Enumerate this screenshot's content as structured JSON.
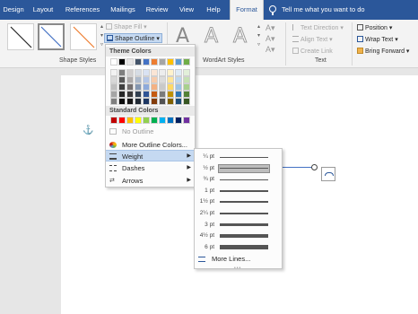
{
  "tabs": [
    {
      "label": "Design",
      "active": false
    },
    {
      "label": "Layout",
      "active": false
    },
    {
      "label": "References",
      "active": false
    },
    {
      "label": "Mailings",
      "active": false
    },
    {
      "label": "Review",
      "active": false
    },
    {
      "label": "View",
      "active": false
    },
    {
      "label": "Help",
      "active": false
    },
    {
      "label": "Format",
      "active": true
    }
  ],
  "tell_me": "Tell me what you want to do",
  "ribbon": {
    "shape_fill": "Shape Fill",
    "shape_outline": "Shape Outline",
    "shape_styles_label": "Shape Styles",
    "wordart_letter": "A",
    "wordart_label": "WordArt Styles",
    "text_direction": "Text Direction",
    "align_text": "Align Text",
    "create_link": "Create Link",
    "text_label": "Text",
    "position": "Position",
    "wrap_text": "Wrap Text",
    "bring_forward": "Bring Forward"
  },
  "outline_menu": {
    "theme_colors_label": "Theme Colors",
    "standard_colors_label": "Standard Colors",
    "theme_top": [
      "#ffffff",
      "#000000",
      "#e7e6e6",
      "#44546a",
      "#4472c4",
      "#ed7d31",
      "#a5a5a5",
      "#ffc000",
      "#5b9bd5",
      "#70ad47"
    ],
    "theme_shades": [
      [
        "#f2f2f2",
        "#7f7f7f",
        "#d0cece",
        "#d6dce4",
        "#d9e2f3",
        "#fbe5d5",
        "#ededed",
        "#fff2cc",
        "#deebf6",
        "#e2efd9"
      ],
      [
        "#d8d8d8",
        "#595959",
        "#aeabab",
        "#adb9ca",
        "#b4c6e7",
        "#f7cbac",
        "#dbdbdb",
        "#fee599",
        "#bdd7ee",
        "#c5e0b3"
      ],
      [
        "#bfbfbf",
        "#3f3f3f",
        "#757070",
        "#8496b0",
        "#8eaadb",
        "#f4b183",
        "#c9c9c9",
        "#ffd965",
        "#9cc3e5",
        "#a8d08d"
      ],
      [
        "#a5a5a5",
        "#262626",
        "#3a3838",
        "#323f4f",
        "#2f5496",
        "#c55a11",
        "#7b7b7b",
        "#bf9000",
        "#2e75b5",
        "#538135"
      ],
      [
        "#7f7f7f",
        "#0c0c0c",
        "#171616",
        "#222a35",
        "#1f3864",
        "#833c0b",
        "#525252",
        "#7f6000",
        "#1e4e79",
        "#375623"
      ]
    ],
    "standard": [
      "#c00000",
      "#ff0000",
      "#ffc000",
      "#ffff00",
      "#92d050",
      "#00b050",
      "#00b0f0",
      "#0070c0",
      "#002060",
      "#7030a0"
    ],
    "no_outline": "No Outline",
    "more_colors": "More Outline Colors...",
    "weight": "Weight",
    "dashes": "Dashes",
    "arrows": "Arrows"
  },
  "weight_menu": {
    "weights": [
      "¼ pt",
      "½ pt",
      "¾ pt",
      "1 pt",
      "1½ pt",
      "2¼ pt",
      "3 pt",
      "4½ pt",
      "6 pt"
    ],
    "selected_index": 1,
    "more_lines": "More Lines..."
  }
}
